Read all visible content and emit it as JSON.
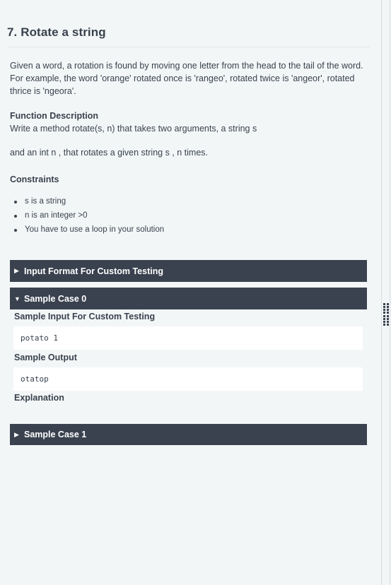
{
  "problem": {
    "title": "7. Rotate a string",
    "description": "Given a word, a rotation is found by moving one letter from the head to the tail of the word. For example, the word 'orange' rotated once is 'rangeo', rotated twice is 'angeor', rotated thrice is 'ngeora'.",
    "function_description": {
      "heading": "Function Description",
      "line1": "Write a method rotate(s, n) that takes two arguments, a string s",
      "line2": "and an int n , that rotates a given string s , n times."
    },
    "constraints": {
      "heading": "Constraints",
      "items": [
        "s is a string",
        "n is an integer >0",
        "You have to use a loop in your solution"
      ]
    }
  },
  "accordions": [
    {
      "label": "Input Format For Custom Testing",
      "expanded": false,
      "icon": "caret-right-icon",
      "glyph": "▶"
    },
    {
      "label": "Sample Case 0",
      "expanded": true,
      "icon": "caret-down-icon",
      "glyph": "▼",
      "sample_input_heading": "Sample Input For Custom Testing",
      "sample_input": "potato 1",
      "sample_output_heading": "Sample Output",
      "sample_output": "otatop",
      "explanation_heading": "Explanation"
    },
    {
      "label": "Sample Case 1",
      "expanded": false,
      "icon": "caret-right-icon",
      "glyph": "▶"
    }
  ],
  "splitter": {
    "icon": "drag-handle-icon"
  }
}
